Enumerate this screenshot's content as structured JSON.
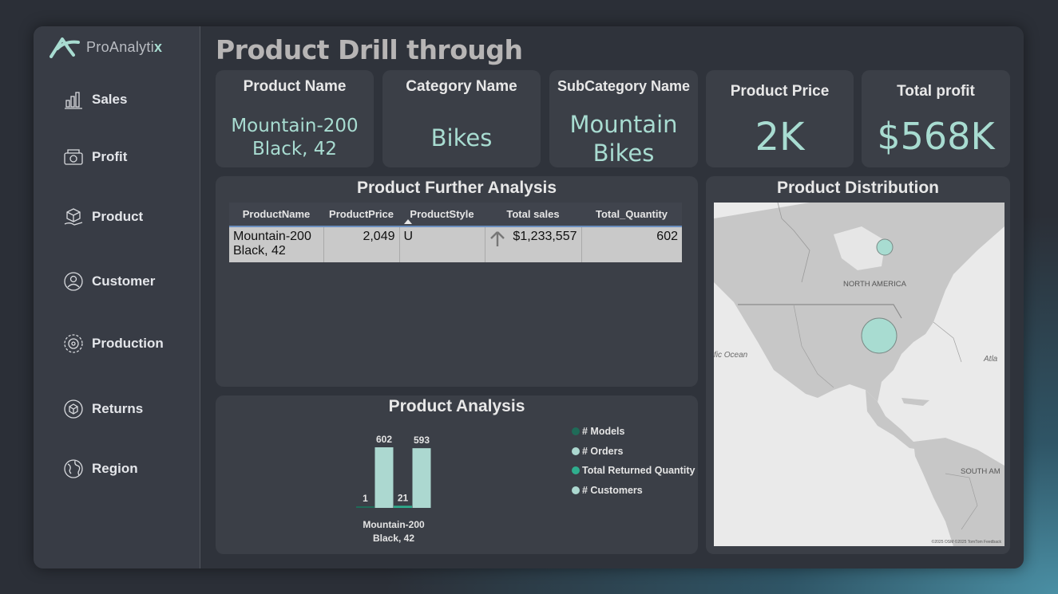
{
  "brand": {
    "name_main": "ProAnalyti",
    "name_accent": "x"
  },
  "sidebar": {
    "items": [
      {
        "label": "Sales",
        "icon": "sales-icon"
      },
      {
        "label": "Profit",
        "icon": "profit-icon"
      },
      {
        "label": "Product",
        "icon": "product-icon"
      },
      {
        "label": "Customer",
        "icon": "customer-icon"
      },
      {
        "label": "Production",
        "icon": "production-icon"
      },
      {
        "label": "Returns",
        "icon": "returns-icon"
      },
      {
        "label": "Region",
        "icon": "region-icon"
      }
    ]
  },
  "page": {
    "title": "Product Drill through"
  },
  "kpis": {
    "product_name": {
      "label": "Product Name",
      "line1": "Mountain-200",
      "line2": "Black, 42"
    },
    "category_name": {
      "label": "Category Name",
      "value": "Bikes"
    },
    "subcategory_name": {
      "label": "SubCategory Name",
      "line1": "Mountain",
      "line2": "Bikes"
    },
    "product_price": {
      "label": "Product Price",
      "value": "2K"
    },
    "total_profit": {
      "label": "Total profit",
      "value": "$568K"
    }
  },
  "further_analysis": {
    "title": "Product Further Analysis",
    "columns": [
      "ProductName",
      "ProductPrice",
      "ProductStyle",
      "Total sales",
      "Total_Quantity"
    ],
    "rows": [
      {
        "name_line1": "Mountain-200",
        "name_line2": "Black, 42",
        "price": "2,049",
        "style": "U",
        "sales": "$1,233,557",
        "quantity": "602"
      }
    ]
  },
  "distribution": {
    "title": "Product Distribution",
    "labels": {
      "north_america": "NORTH AMERICA",
      "pacific": "fic Ocean",
      "atlantic": "Atla",
      "south_america": "SOUTH AM",
      "credits": "©2025 OSM ©2025 TomTom Feedback"
    }
  },
  "chart_data": {
    "type": "bar",
    "title": "Product Analysis",
    "categories": [
      "Mountain-200 Black, 42"
    ],
    "category_line1": "Mountain-200",
    "category_line2": "Black, 42",
    "series": [
      {
        "name": "# Models",
        "values": [
          1
        ],
        "color": "#1f6b58"
      },
      {
        "name": "# Orders",
        "values": [
          602
        ],
        "color": "#acd8d0"
      },
      {
        "name": "Total Returned Quantity",
        "values": [
          21
        ],
        "color": "#2fae8e"
      },
      {
        "name": "# Customers",
        "values": [
          593
        ],
        "color": "#acd8d0"
      }
    ],
    "ylim": [
      0,
      602
    ]
  },
  "colors": {
    "accent": "#a8dcd1",
    "panel": "#3b3f47",
    "background": "#2f333b"
  }
}
